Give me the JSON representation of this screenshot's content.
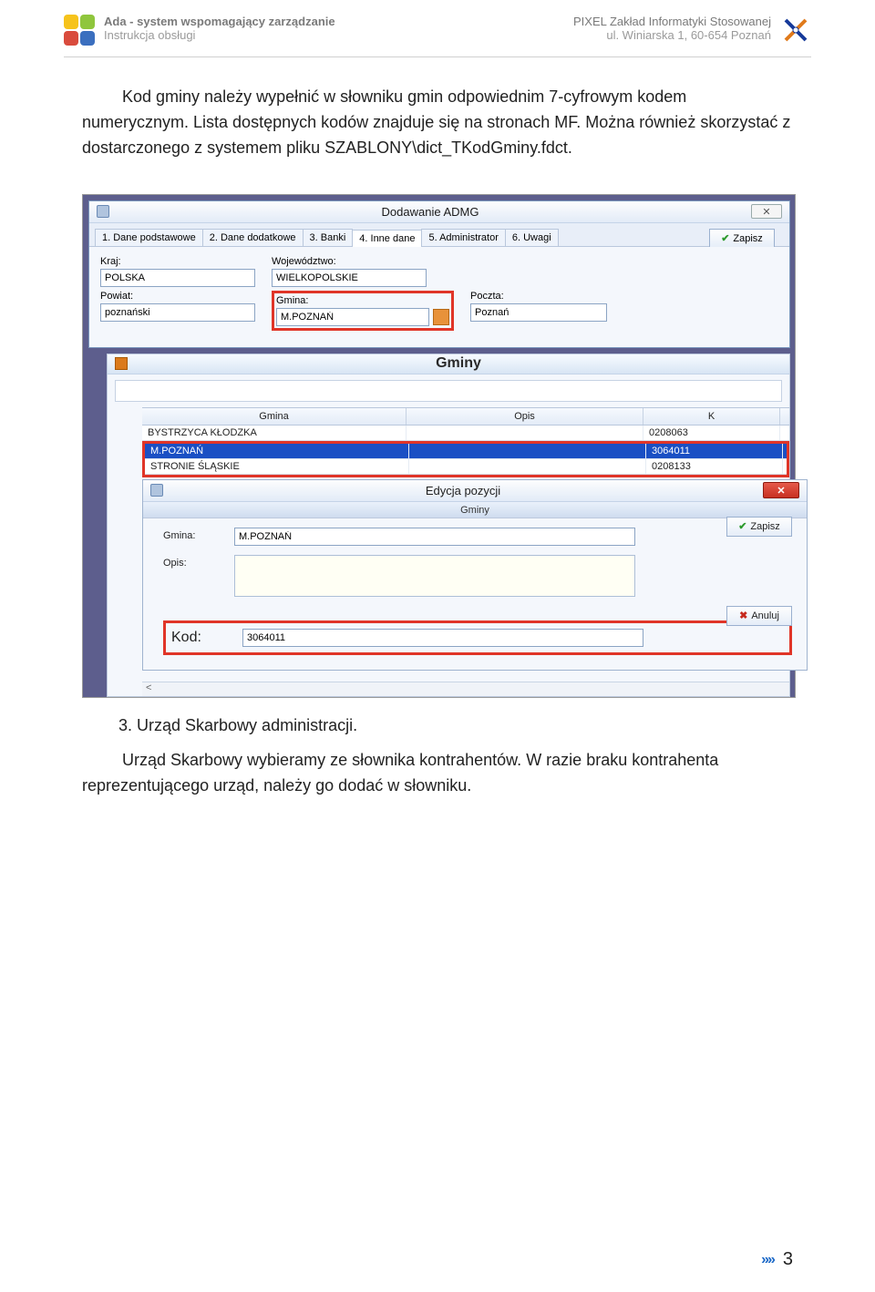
{
  "header": {
    "doc_title": "Ada - system wspomagający zarządzanie",
    "doc_sub": "Instrukcja obsługi",
    "company": "PIXEL Zakład Informatyki Stosowanej",
    "addr": "ul. Winiarska 1, 60-654 Poznań"
  },
  "para1_a": "Kod gminy należy wypełnić w słowniku gmin odpowiednim 7-cyfrowym kodem numerycznym. Lista dostępnych kodów znajduje się na stronach MF. Można również skorzystać z dostarczonego z systemem pliku SZABLONY\\dict_TKodGminy.fdct.",
  "win1": {
    "title": "Dodawanie ADMG",
    "close": "✕",
    "zapisz": "Zapisz",
    "tabs": [
      "1. Dane podstawowe",
      "2. Dane dodatkowe",
      "3. Banki",
      "4. Inne dane",
      "5. Administrator",
      "6. Uwagi"
    ],
    "labels": {
      "kraj": "Kraj:",
      "woj": "Województwo:",
      "powiat": "Powiat:",
      "gmina": "Gmina:",
      "poczta": "Poczta:"
    },
    "vals": {
      "kraj": "POLSKA",
      "woj": "WIELKOPOLSKIE",
      "powiat": "poznański",
      "gmina": "M.POZNAŃ",
      "poczta": "Poznań"
    }
  },
  "gminy": {
    "title": "Gminy",
    "cols": {
      "g": "Gmina",
      "o": "Opis",
      "k": "K"
    },
    "r1": {
      "g": "BYSTRZYCA KŁODZKA",
      "o": "",
      "k": "0208063"
    },
    "r2": {
      "g": "M.POZNAŃ",
      "o": "",
      "k": "3064011"
    },
    "r3": {
      "g": "STRONIE ŚLĄSKIE",
      "o": "",
      "k": "0208133"
    }
  },
  "edit": {
    "title": "Edycja pozycji",
    "sub": "Gminy",
    "zapisz": "Zapisz",
    "anuluj": "Anuluj",
    "gmina_l": "Gmina:",
    "gmina_v": "M.POZNAŃ",
    "opis_l": "Opis:",
    "opis_v": "",
    "kod_l": "Kod:",
    "kod_v": "3064011"
  },
  "item3": "3.  Urząd Skarbowy administracji.",
  "para2": "Urząd Skarbowy wybieramy ze słownika kontrahentów. W razie braku kontrahenta reprezentującego urząd, należy go dodać w słowniku.",
  "page_no": "3"
}
